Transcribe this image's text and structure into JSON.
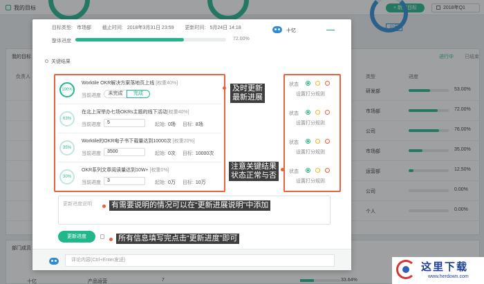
{
  "background": {
    "app_title": "我的目标",
    "new_goal_button": "+ 新建目标",
    "quarter_select": "2018年Q1",
    "company_badge": "公司",
    "panel_title": "我的目标",
    "tabs": [
      "进行中",
      "已结束"
    ],
    "columns": {
      "owner": "负责人",
      "type": "类型",
      "progress": "进度"
    },
    "rows": [
      {
        "type": "研发部",
        "progress": 0.53,
        "pct": "53.00%"
      },
      {
        "type": "市场部",
        "progress": 0.72,
        "pct": "72.00%"
      },
      {
        "type": "公司",
        "progress": 0.76,
        "pct": "76.00%"
      },
      {
        "type": "市场部",
        "progress": 0.35,
        "pct": "35.00%"
      },
      {
        "type": "运营部",
        "progress": 0.125,
        "pct": "12.50%"
      },
      {
        "type": "公司",
        "progress": 0,
        "pct": "0.00%"
      },
      {
        "type": "个人",
        "progress": 0,
        "pct": "0.00%"
      }
    ],
    "dept_panel_title": "部门成员",
    "dept_row": {
      "name": "十亿",
      "dept": "产品运营",
      "count": "7",
      "progress": 0.3364,
      "pct": "33.64%"
    }
  },
  "modal": {
    "meta": [
      {
        "key": "目标类型:",
        "value": "市场部"
      },
      {
        "key": "截止时间:",
        "value": "2018年3月31日 23:59"
      },
      {
        "key": "更新时间:",
        "value": "5月24日 14:18"
      }
    ],
    "overall_label": "整体进度",
    "overall_progress": 0.72,
    "overall_pct": "72.00%",
    "owner_name": "十亿",
    "kr_section_title": "关键结果",
    "progress_label": "当前进度",
    "start_label": "起始:",
    "target_label": "目标:",
    "toggle": {
      "incomplete": "未完成",
      "complete": "完成"
    },
    "key_results": [
      {
        "ring": "100%",
        "title": "Worktile OKR解决方案落地页上线",
        "weight": "[权重40%]",
        "kind": "toggle"
      },
      {
        "ring": "63%",
        "title": "在北上深举办七场OKRs主题的线下活动",
        "weight": "[权重40%]",
        "kind": "number",
        "current": "5",
        "start": "0场",
        "target": "8场"
      },
      {
        "ring": "35%",
        "title": "Worktile的OKR电子书下载量达到10000次",
        "weight": "[权重20%]",
        "kind": "number",
        "current": "3500",
        "start": "0次",
        "target": "10000次"
      },
      {
        "ring": "30%",
        "title": "OKR系列文章阅读量达到10W+",
        "weight": "[权重0%]",
        "kind": "number",
        "current": "3",
        "start": "0万",
        "target": "10万"
      }
    ],
    "status_label": "状态",
    "scoring_rule": "设置打分规则",
    "note_placeholder": "更新进度说明",
    "update_button": "更新进度",
    "comment_placeholder": "评论内容(Ctrl+Enter发送)"
  },
  "callouts": {
    "timely_update": "及时更新\n最新进展",
    "status_note": "注意关键结果\n状态正常与否",
    "note_hint": "有需要说明的情况可以在“更新进展说明”中添加",
    "submit_hint": "所有信息填写完点击“更新进度”即可"
  },
  "watermark": {
    "name": "这里下载",
    "url": "www.herdown.com"
  },
  "colors": {
    "accent": "#21b68c",
    "callout_border": "#e8603c",
    "blue": "#2d8cd6",
    "warning": "#f5b624"
  }
}
